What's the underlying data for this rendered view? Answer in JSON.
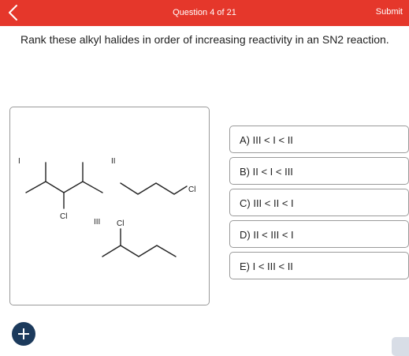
{
  "header": {
    "title": "Question 4 of 21",
    "submit_label": "Submit",
    "back_icon": "chevron-left-icon",
    "accent_color": "#e5372b"
  },
  "question": {
    "text": "Rank these alkyl halides in order of increasing reactivity in an SN2 reaction."
  },
  "structures": {
    "label_1": "I",
    "label_2": "II",
    "label_3": "III",
    "halogen_1": "Cl",
    "halogen_2": "Cl",
    "halogen_3": "Cl"
  },
  "choices": [
    {
      "label": "A) III < I < II"
    },
    {
      "label": "B) II < I < III"
    },
    {
      "label": "C) III < II < I"
    },
    {
      "label": "D) II < III < I"
    },
    {
      "label": "E) I < III < II"
    }
  ],
  "footer": {
    "add_icon": "plus-icon",
    "add_button_color": "#1c3a5c"
  }
}
